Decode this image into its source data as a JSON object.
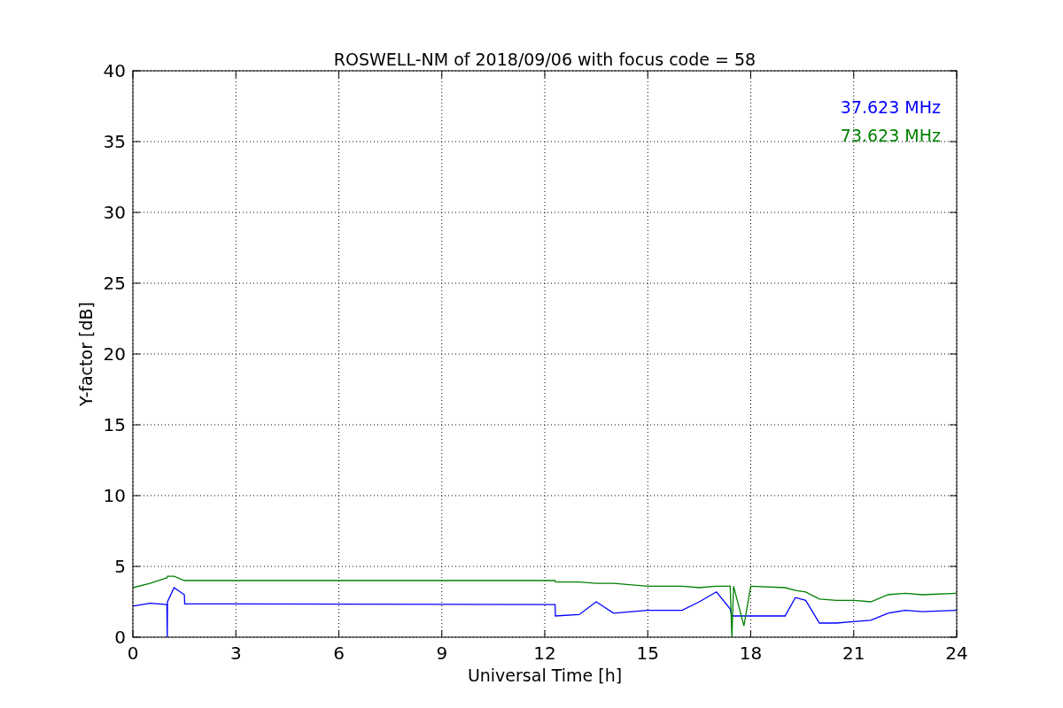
{
  "chart_data": {
    "type": "line",
    "title": "ROSWELL-NM of 2018/09/06 with focus code = 58",
    "xlabel": "Universal Time [h]",
    "ylabel": "Y-factor [dB]",
    "x": [
      0,
      0.5,
      0.99,
      1.0,
      1.01,
      1.2,
      1.5,
      1.51,
      3,
      6,
      9,
      12,
      12.3,
      12.31,
      13,
      13.5,
      14,
      15,
      16,
      16.5,
      17,
      17.4,
      17.45,
      17.5,
      17.8,
      18,
      19,
      19.3,
      19.6,
      20,
      20.5,
      21,
      21.5,
      22,
      22.5,
      23,
      24
    ],
    "series": [
      {
        "name": "37.623 MHz",
        "color": "#0000ff",
        "values": [
          2.2,
          2.4,
          2.3,
          0,
          2.5,
          3.5,
          3.0,
          2.35,
          2.35,
          2.33,
          2.32,
          2.3,
          2.3,
          1.5,
          1.6,
          2.5,
          1.7,
          1.9,
          1.9,
          2.5,
          3.2,
          2.0,
          1.5,
          1.5,
          1.5,
          1.5,
          1.5,
          2.8,
          2.6,
          1.0,
          1.0,
          1.1,
          1.2,
          1.7,
          1.9,
          1.8,
          1.9
        ]
      },
      {
        "name": "73.623 MHz",
        "color": "#008000",
        "values": [
          3.5,
          3.8,
          4.2,
          4.2,
          4.3,
          4.3,
          4.0,
          4.0,
          4.0,
          4.0,
          4.0,
          4.0,
          4.0,
          3.9,
          3.9,
          3.8,
          3.8,
          3.6,
          3.6,
          3.5,
          3.6,
          3.6,
          0,
          3.6,
          0.8,
          3.6,
          3.5,
          3.3,
          3.2,
          2.7,
          2.6,
          2.6,
          2.5,
          3.0,
          3.1,
          3.0,
          3.1
        ]
      }
    ],
    "xlim": [
      0,
      24
    ],
    "ylim": [
      0,
      40
    ],
    "xticks": [
      0,
      3,
      6,
      9,
      12,
      15,
      18,
      21,
      24
    ],
    "yticks": [
      0,
      5,
      10,
      15,
      20,
      25,
      30,
      35,
      40
    ],
    "grid": true
  }
}
